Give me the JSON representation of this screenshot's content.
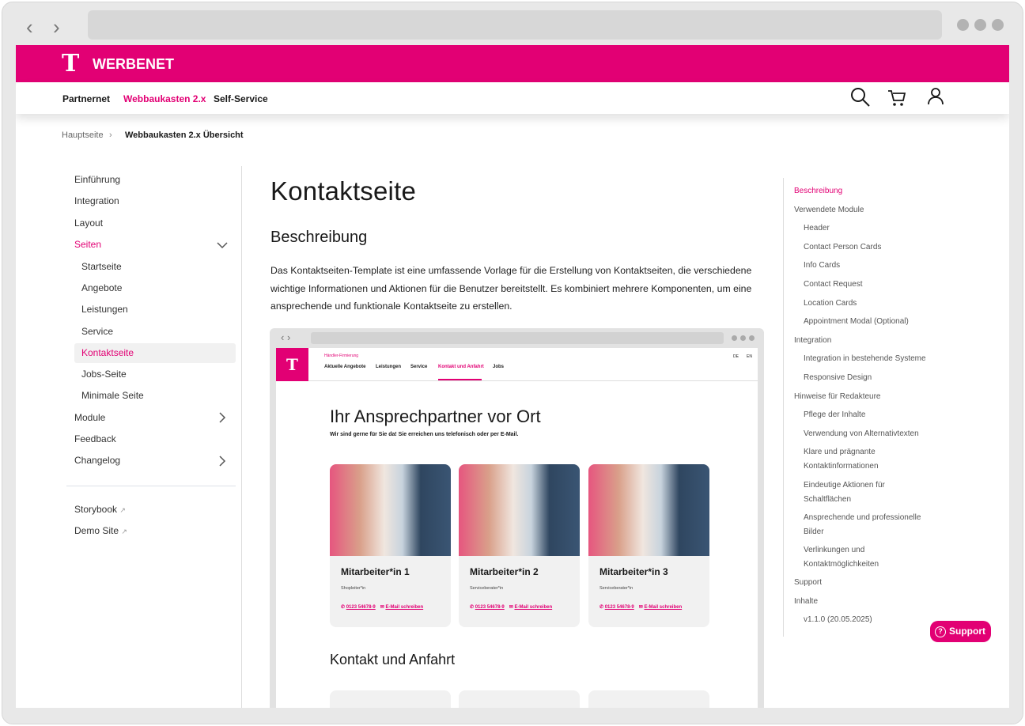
{
  "brand": {
    "logo": "T",
    "name": "WERBENET",
    "color": "#e20074"
  },
  "topnav": {
    "items": [
      "Partnernet",
      "Webbaukasten 2.x",
      "Self-Service"
    ]
  },
  "breadcrumb": {
    "home": "Hauptseite",
    "current": "Webbaukasten 2.x Übersicht"
  },
  "leftnav": {
    "items": [
      "Einführung",
      "Integration",
      "Layout",
      "Seiten",
      "Startseite",
      "Angebote",
      "Leistungen",
      "Service",
      "Kontaktseite",
      "Jobs-Seite",
      "Minimale Seite",
      "Module",
      "Feedback",
      "Changelog"
    ],
    "links": [
      "Storybook",
      "Demo Site"
    ]
  },
  "main": {
    "title": "Kontaktseite",
    "section": "Beschreibung",
    "paragraph": "Das Kontaktseiten-Template ist eine umfassende Vorlage für die Erstellung von Kontaktseiten, die verschiedene wichtige Informationen und Aktionen für die Benutzer bereitstellt. Es kombiniert mehrere Komponenten, um eine ansprechende und funktionale Kontaktseite zu erstellen."
  },
  "preview": {
    "logo": "T",
    "firm": "Händler-Firmierung",
    "nav": [
      "Aktuelle Angebote",
      "Leistungen",
      "Service",
      "Kontakt und Anfahrt",
      "Jobs"
    ],
    "langs": [
      "DE",
      "EN"
    ],
    "heading": "Ihr Ansprechpartner vor Ort",
    "subheading": "Wir sind gerne für Sie da! Sie erreichen uns telefonisch oder per E-Mail.",
    "cards": [
      {
        "name": "Mitarbeiter*in 1",
        "role": "Shopleiter*in",
        "phone": "0123 54678-9",
        "email": "E-Mail schreiben"
      },
      {
        "name": "Mitarbeiter*in 2",
        "role": "Serviceberater*in",
        "phone": "0123 54678-9",
        "email": "E-Mail schreiben"
      },
      {
        "name": "Mitarbeiter*in 3",
        "role": "Serviceberater*in",
        "phone": "0123 54678-9",
        "email": "E-Mail schreiben"
      }
    ],
    "section2": "Kontakt und Anfahrt"
  },
  "toc": {
    "items": [
      "Beschreibung",
      "Verwendete Module",
      "Header",
      "Contact Person Cards",
      "Info Cards",
      "Contact Request",
      "Location Cards",
      "Appointment Modal (Optional)",
      "Integration",
      "Integration in bestehende Systeme",
      "Responsive Design",
      "Hinweise für Redakteure",
      "Pflege der Inhalte",
      "Verwendung von Alternativtexten",
      "Klare und prägnante Kontaktinformationen",
      "Eindeutige Aktionen für Schaltflächen",
      "Ansprechende und professionelle Bilder",
      "Verlinkungen und Kontaktmöglichkeiten",
      "Support",
      "Inhalte",
      "v1.1.0 (20.05.2025)"
    ]
  },
  "support": {
    "label": "Support"
  }
}
